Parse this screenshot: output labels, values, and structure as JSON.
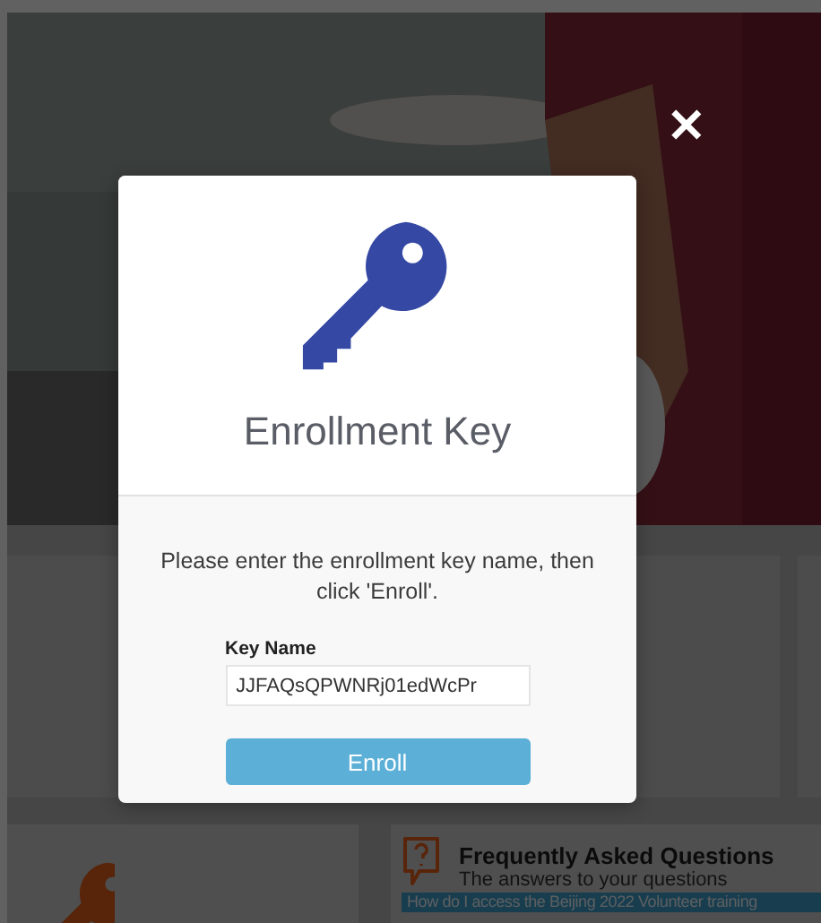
{
  "background_page": {
    "faq_card": {
      "title": "Frequently Asked Questions",
      "subtitle": "The answers to your questions",
      "link": "How do I access the Beijing 2022 Volunteer training"
    }
  },
  "dialog": {
    "close": "✕",
    "title": "Enrollment Key",
    "instructions": "Please enter the enrollment key name, then click 'Enroll'.",
    "field_label": "Key Name",
    "field_value": "JJFAQsQPWNRj01edWcPr",
    "button": "Enroll"
  }
}
